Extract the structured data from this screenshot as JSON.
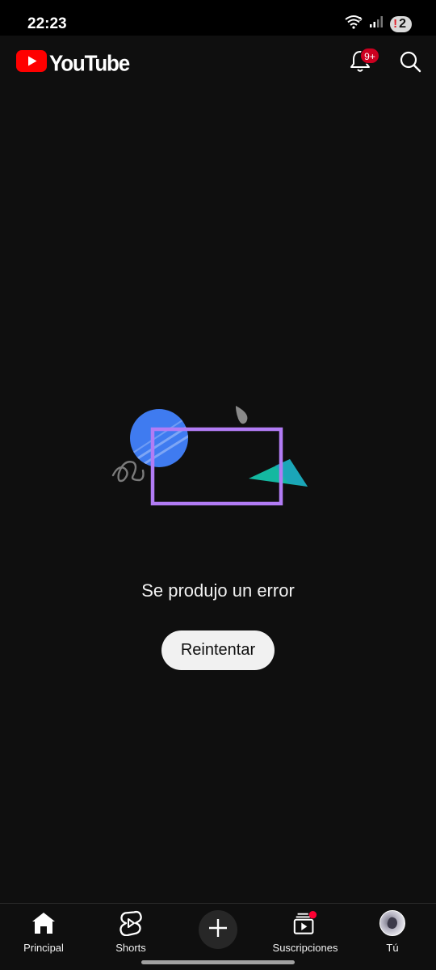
{
  "status_bar": {
    "time": "22:23",
    "notification_badge": "2",
    "icons": [
      "wifi-icon",
      "signal-icon",
      "alert-badge"
    ]
  },
  "header": {
    "logo_text": "YouTube",
    "notification_count": "9+",
    "icons": [
      "bell-icon",
      "search-icon"
    ],
    "brand_color": "#ff0000"
  },
  "main": {
    "error_message": "Se produjo un error",
    "retry_label": "Reintentar",
    "illustration_colors": {
      "circle": "#3f7bf0",
      "frame": "#b27cf5",
      "triangle": "#14b8a0",
      "stroke": "#7a7a7a"
    }
  },
  "bottom_nav": {
    "items": [
      {
        "label": "Principal",
        "icon": "home-icon"
      },
      {
        "label": "Shorts",
        "icon": "shorts-icon"
      },
      {
        "label": "",
        "icon": "plus-icon"
      },
      {
        "label": "Suscripciones",
        "icon": "subscriptions-icon"
      },
      {
        "label": "Tú",
        "icon": "avatar"
      }
    ]
  }
}
